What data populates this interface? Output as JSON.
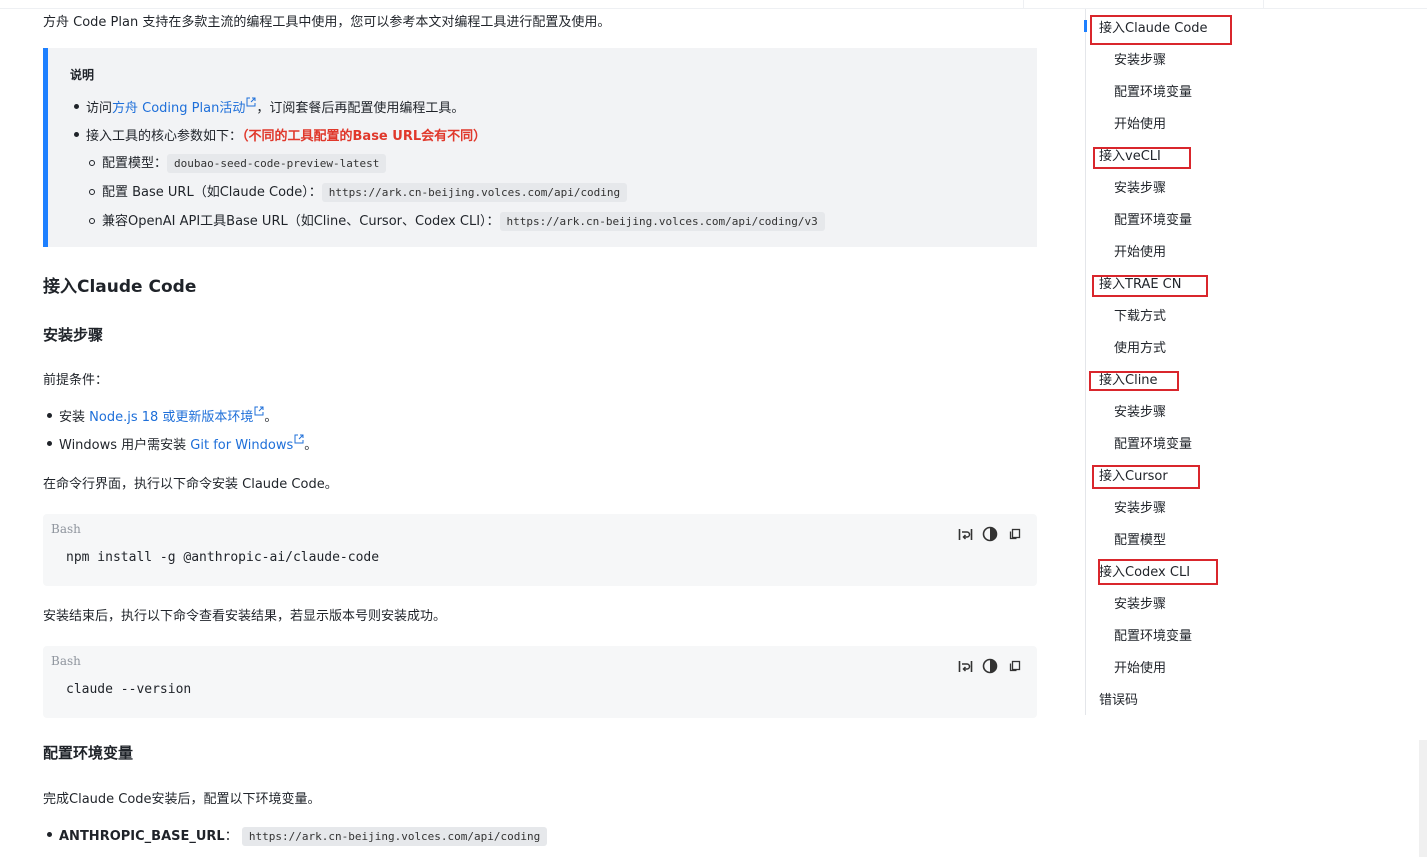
{
  "intro": "方舟 Code Plan 支持在多款主流的编程工具中使用，您可以参考本文对编程工具进行配置及使用。",
  "note": {
    "title": "说明",
    "line1_prefix": "访问",
    "line1_link": "方舟 Coding Plan活动",
    "line1_suffix": "，订阅套餐后再配置使用编程工具。",
    "line2_prefix": "接入工具的核心参数如下：",
    "line2_red": "（不同的工具配置的Base URL会有不同）",
    "sub1_label": "配置模型：",
    "sub1_code": "doubao-seed-code-preview-latest",
    "sub2_label": "配置 Base URL（如Claude Code）：",
    "sub2_code": "https://ark.cn-beijing.volces.com/api/coding",
    "sub3_label": "兼容OpenAI API工具Base URL（如Cline、Cursor、Codex CLI）：",
    "sub3_code": "https://ark.cn-beijing.volces.com/api/coding/v3"
  },
  "section": {
    "h2": "接入Claude Code",
    "h3_install": "安装步骤",
    "prereq": "前提条件：",
    "bullet1_prefix": "安装 ",
    "bullet1_link": "Node.js 18 或更新版本环境",
    "bullet1_suffix": "。",
    "bullet2_prefix": "Windows 用户需安装 ",
    "bullet2_link": "Git for Windows",
    "bullet2_suffix": "。",
    "install_text": "在命令行界面，执行以下命令安装 Claude Code。",
    "code1_lang": "Bash",
    "code1": "npm install -g @anthropic-ai/claude-code",
    "after_install": "安装结束后，执行以下命令查看安装结果，若显示版本号则安装成功。",
    "code2_lang": "Bash",
    "code2": "claude --version",
    "h3_env": "配置环境变量",
    "env_text": "完成Claude Code安装后，配置以下环境变量。",
    "env_key": "ANTHROPIC_BASE_URL",
    "env_colon": "：",
    "env_code": "https://ark.cn-beijing.volces.com/api/coding"
  },
  "toc": [
    {
      "label": "接入Claude Code",
      "level": "top"
    },
    {
      "label": "安装步骤",
      "level": "sub"
    },
    {
      "label": "配置环境变量",
      "level": "sub"
    },
    {
      "label": "开始使用",
      "level": "sub"
    },
    {
      "label": "接入veCLI",
      "level": "top"
    },
    {
      "label": "安装步骤",
      "level": "sub"
    },
    {
      "label": "配置环境变量",
      "level": "sub"
    },
    {
      "label": "开始使用",
      "level": "sub"
    },
    {
      "label": "接入TRAE CN",
      "level": "top"
    },
    {
      "label": "下载方式",
      "level": "sub"
    },
    {
      "label": "使用方式",
      "level": "sub"
    },
    {
      "label": "接入Cline",
      "level": "top"
    },
    {
      "label": "安装步骤",
      "level": "sub"
    },
    {
      "label": "配置环境变量",
      "level": "sub"
    },
    {
      "label": "接入Cursor",
      "level": "top"
    },
    {
      "label": "安装步骤",
      "level": "sub"
    },
    {
      "label": "配置模型",
      "level": "sub"
    },
    {
      "label": "接入Codex CLI",
      "level": "top"
    },
    {
      "label": "安装步骤",
      "level": "sub"
    },
    {
      "label": "配置环境变量",
      "level": "sub"
    },
    {
      "label": "开始使用",
      "level": "sub"
    },
    {
      "label": "错误码",
      "level": "top"
    }
  ],
  "colors": {
    "accent": "#1e80ff",
    "link": "#1e6fd9",
    "warning_red": "#e0382b",
    "annotation_red": "#d9262c"
  },
  "icons": {
    "external_link": "external-link-icon",
    "wrap": "wrap-icon",
    "theme": "theme-icon",
    "copy": "copy-icon"
  }
}
